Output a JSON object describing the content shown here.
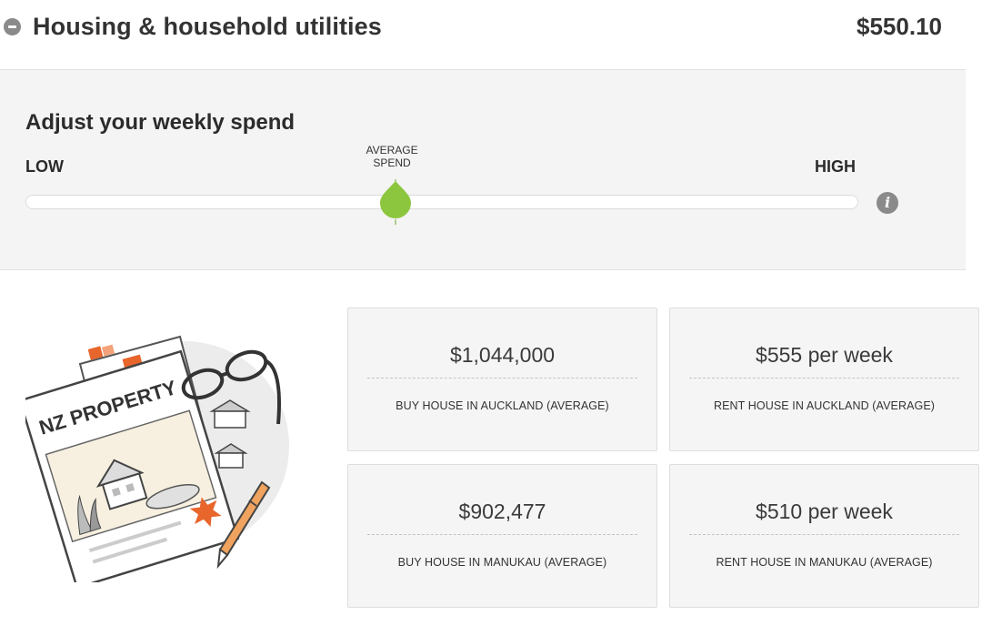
{
  "header": {
    "title": "Housing & household utilities",
    "total": "$550.10"
  },
  "adjust": {
    "title": "Adjust your weekly spend",
    "low_label": "LOW",
    "high_label": "HIGH",
    "average_label_line1": "AVERAGE",
    "average_label_line2": "SPEND",
    "slider_level": 0.44,
    "thumb_color": "#8cc63f",
    "info_icon_glyph": "i"
  },
  "illustration": {
    "sign_text": "NZ PROPERTY",
    "accent_color": "#e8652b"
  },
  "cards": [
    {
      "value": "$1,044,000",
      "caption": "BUY HOUSE IN AUCKLAND (AVERAGE)"
    },
    {
      "value": "$555 per week",
      "caption": "RENT HOUSE IN AUCKLAND (AVERAGE)"
    },
    {
      "value": "$902,477",
      "caption": "BUY HOUSE IN MANUKAU (AVERAGE)"
    },
    {
      "value": "$510 per week",
      "caption": "RENT HOUSE IN MANUKAU (AVERAGE)"
    }
  ]
}
